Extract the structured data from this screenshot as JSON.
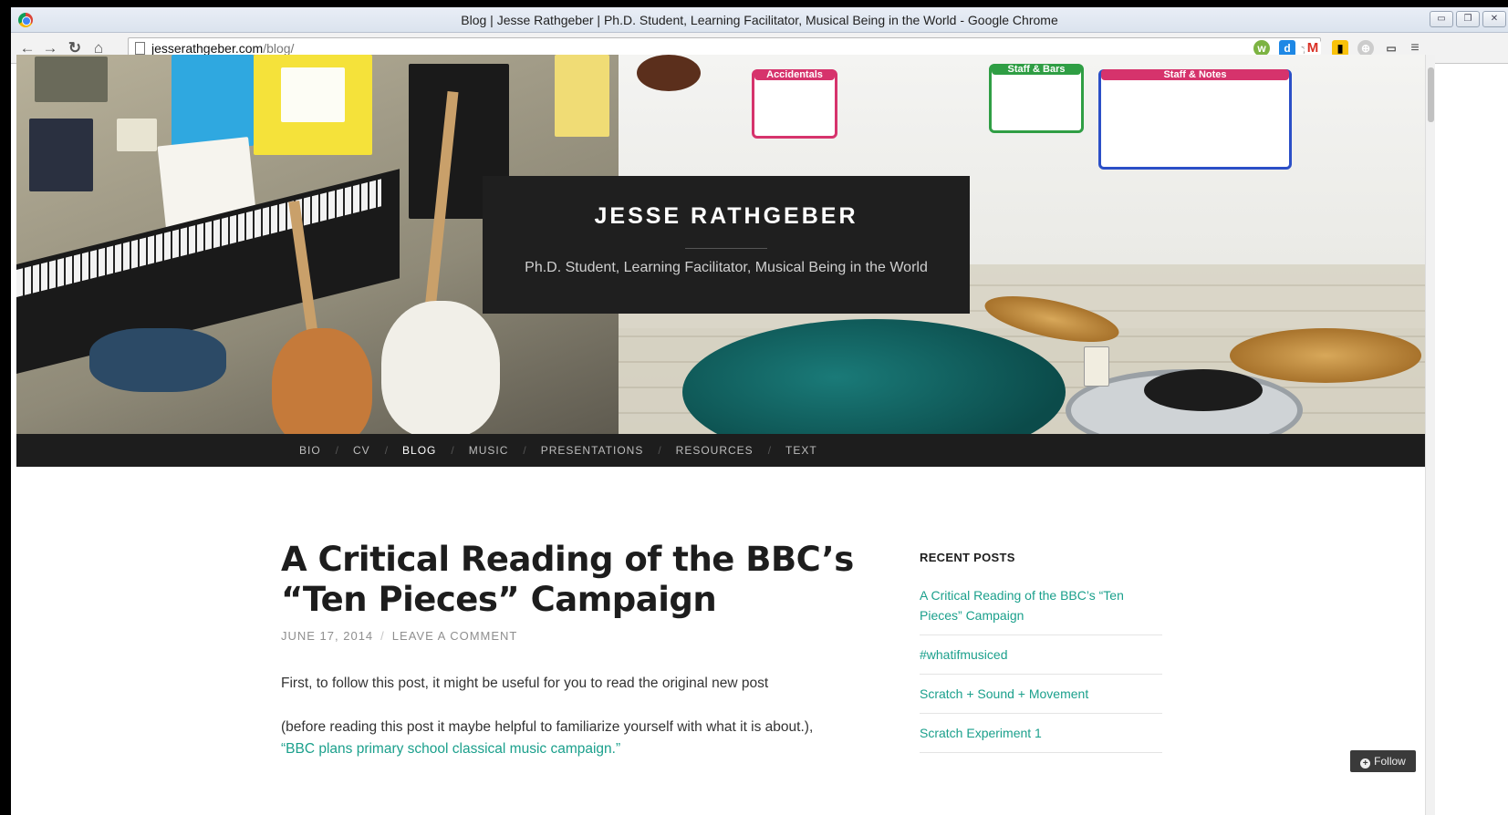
{
  "window": {
    "title": "Blog | Jesse Rathgeber | Ph.D. Student, Learning Facilitator, Musical Being in the World - Google Chrome",
    "controls": [
      "minimize",
      "restore",
      "close"
    ]
  },
  "toolbar": {
    "url_host": "jesserathgeber.com",
    "url_path": "/blog/",
    "back_icon": "back-arrow-icon",
    "forward_icon": "forward-arrow-icon",
    "reload_icon": "reload-icon",
    "home_icon": "home-icon",
    "bookmark_icon": "star-icon"
  },
  "site": {
    "title": "JESSE RATHGEBER",
    "tagline": "Ph.D. Student, Learning Facilitator, Musical Being in the World"
  },
  "nav": {
    "items": [
      "BIO",
      "CV",
      "BLOG",
      "MUSIC",
      "PRESENTATIONS",
      "RESOURCES",
      "TEXT"
    ],
    "active": "BLOG"
  },
  "post": {
    "title_line1": "A Critical Reading of the BBC’s",
    "title_line2": "“Ten Pieces” Campaign",
    "date": "JUNE 17, 2014",
    "comment_link": "LEAVE A COMMENT",
    "para1": "First, to follow this post, it might be useful for you to read the original new post",
    "para2": "(before reading this post it maybe helpful to familiarize yourself with what it is about.),",
    "para2_link": "“BBC plans primary school classical music campaign.”"
  },
  "sidebar": {
    "widget_title": "RECENT POSTS",
    "recent_posts": [
      "A Critical Reading of the BBC’s “Ten Pieces” Campaign",
      "#whatifmusiced",
      "Scratch + Sound + Movement",
      "Scratch Experiment 1"
    ]
  },
  "follow_button": {
    "label": "Follow"
  },
  "colors": {
    "accent_link": "#1ba08c",
    "nav_bg": "#1d1d1d",
    "title_box_bg": "#1f1f1f"
  }
}
